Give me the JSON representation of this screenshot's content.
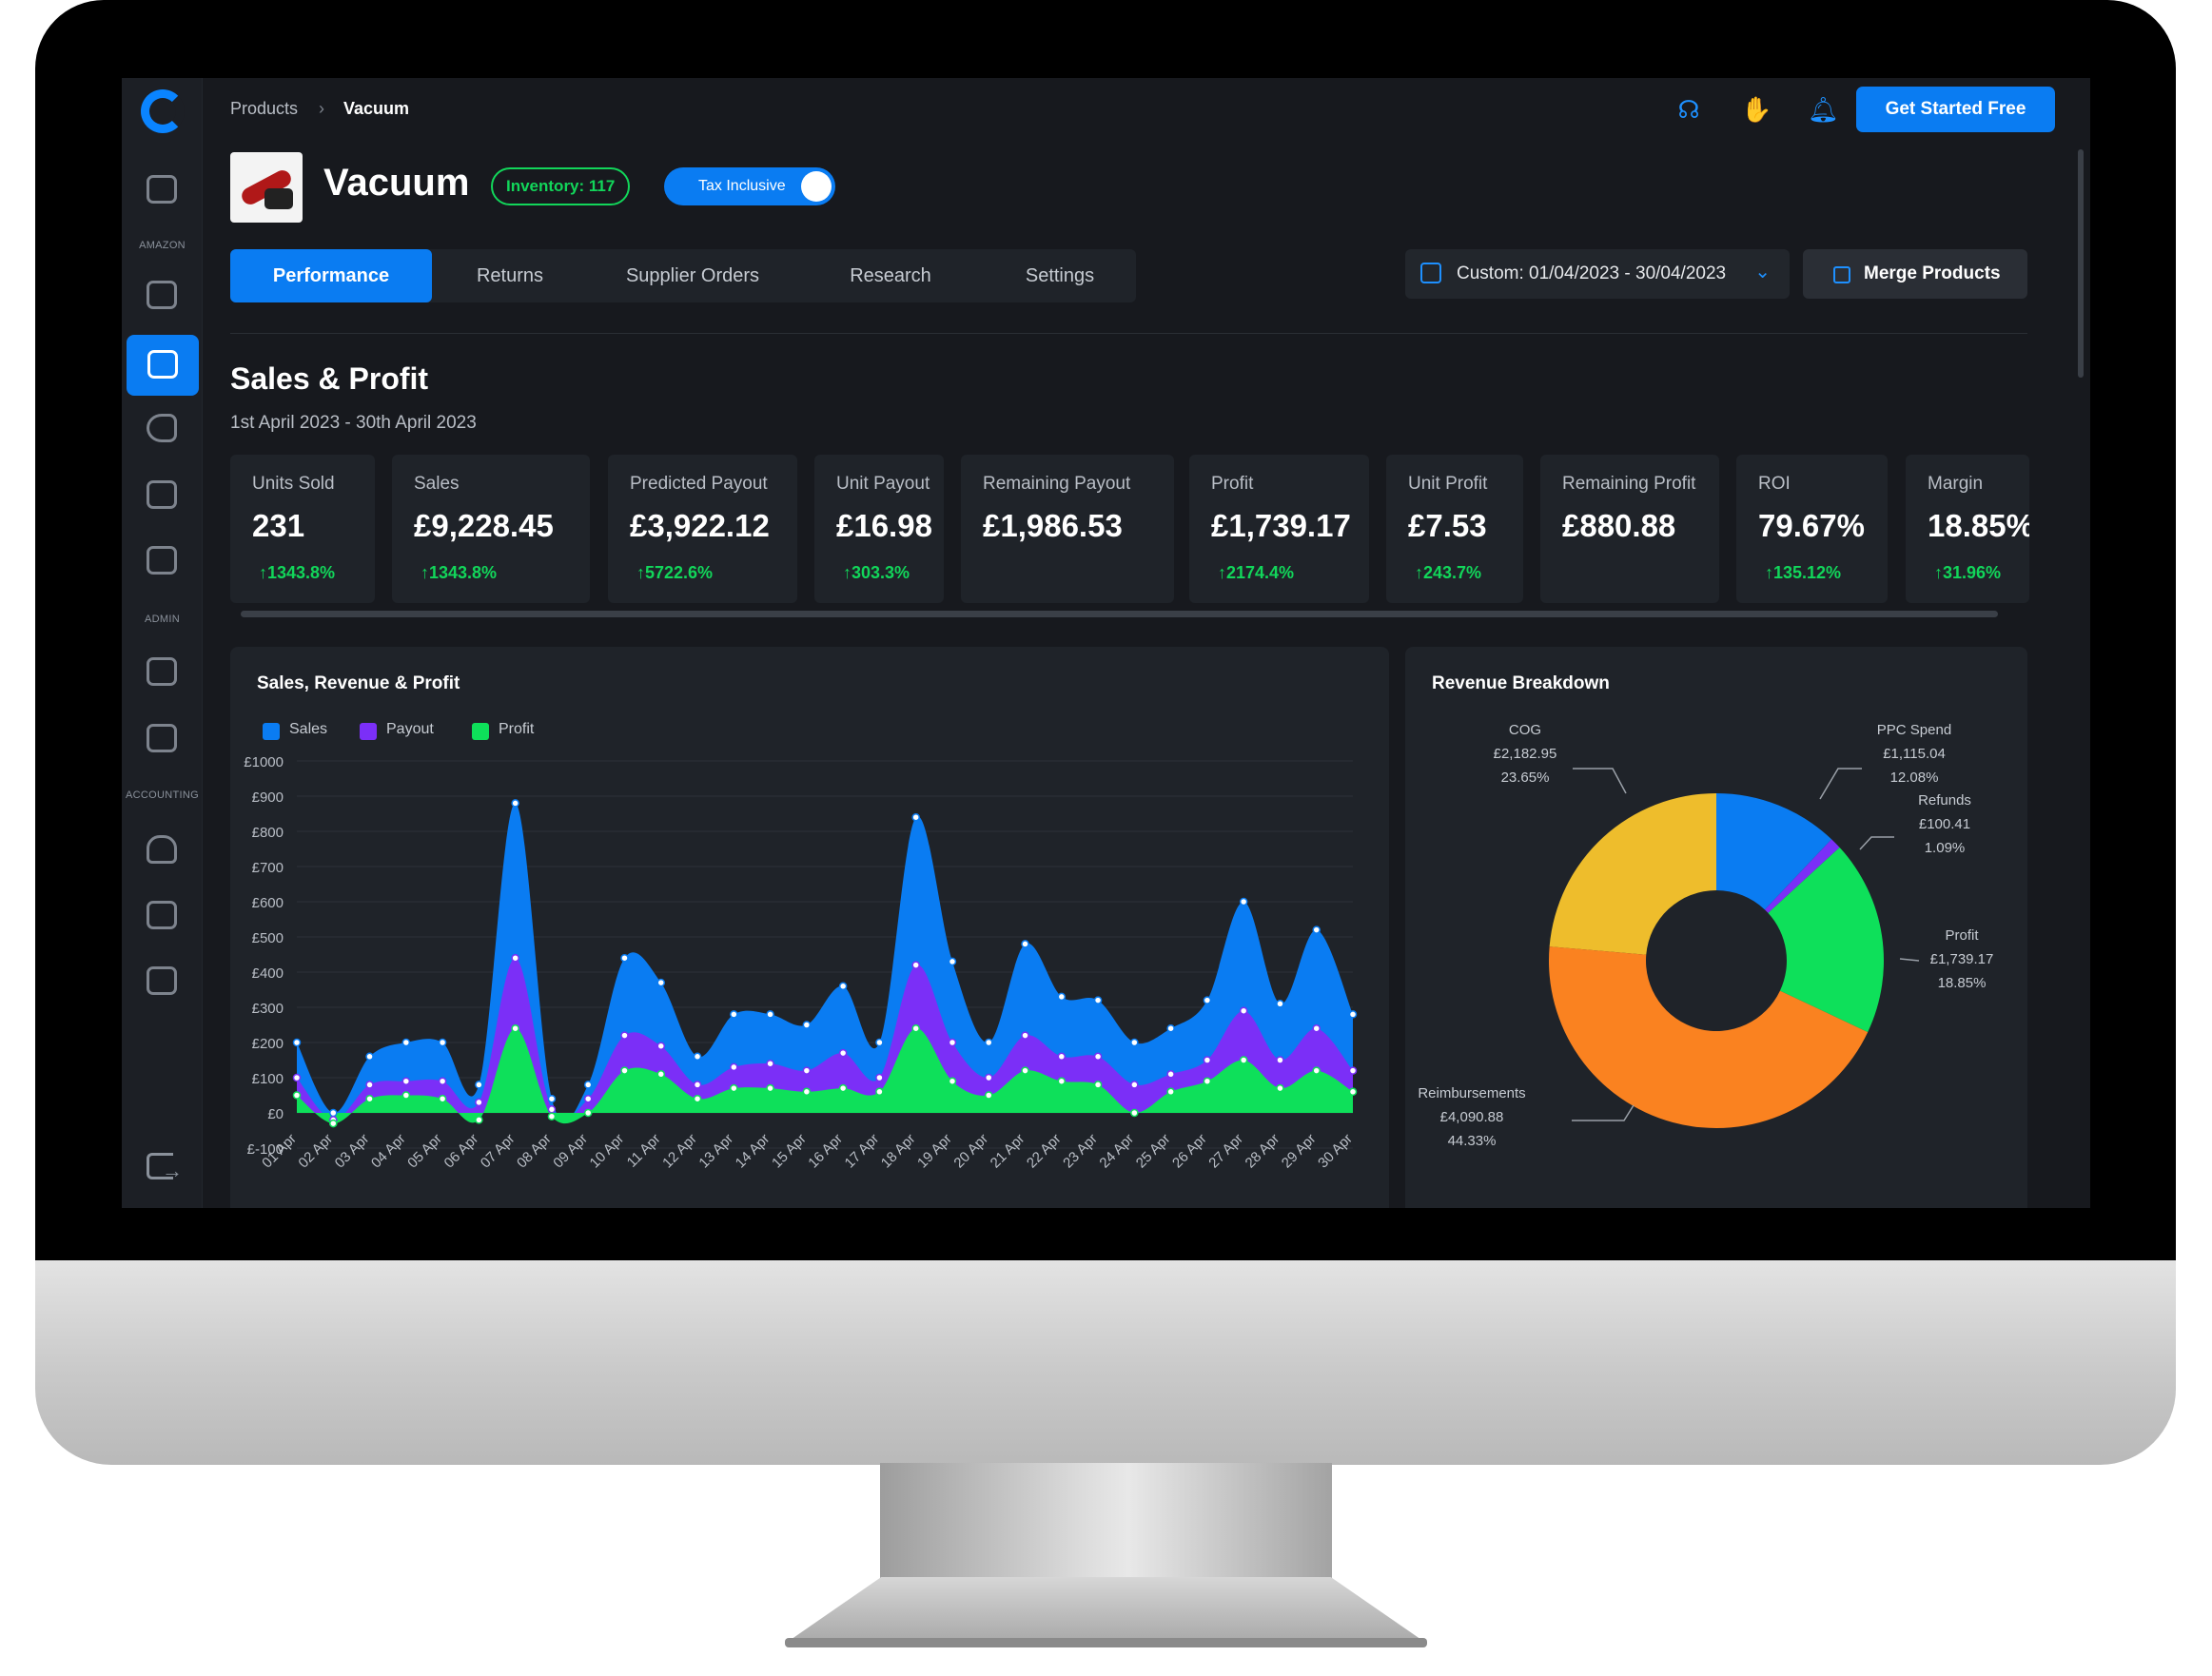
{
  "breadcrumb": {
    "parent": "Products",
    "separator": "›",
    "current": "Vacuum"
  },
  "sidebar": {
    "sections": [
      "AMAZON",
      "ADMIN",
      "ACCOUNTING"
    ],
    "items": [
      {
        "icon": "dashboard-icon"
      },
      {
        "icon": "analytics-icon"
      },
      {
        "icon": "products-icon",
        "active": true
      },
      {
        "icon": "megaphone-icon"
      },
      {
        "icon": "repricer-icon"
      },
      {
        "icon": "reviews-icon"
      },
      {
        "icon": "shipments-icon"
      },
      {
        "icon": "orders-icon"
      },
      {
        "icon": "store-icon"
      },
      {
        "icon": "reports-icon"
      },
      {
        "icon": "wallet-icon"
      },
      {
        "icon": "logout-icon"
      }
    ]
  },
  "header": {
    "cta": "Get Started Free",
    "icons": [
      "support-icon",
      "wave-icon",
      "bell-icon"
    ]
  },
  "product": {
    "title": "Vacuum",
    "inventory": "Inventory: 117",
    "tax_toggle": "Tax Inclusive"
  },
  "tabs": [
    "Performance",
    "Returns",
    "Supplier Orders",
    "Research",
    "Settings"
  ],
  "date_range": "Custom: 01/04/2023 - 30/04/2023",
  "merge_button": "Merge Products",
  "section": {
    "title": "Sales & Profit",
    "subtitle": "1st April 2023 - 30th April 2023"
  },
  "kpis": [
    {
      "label": "Units Sold",
      "value": "231",
      "change": "1343.8%"
    },
    {
      "label": "Sales",
      "value": "£9,228.45",
      "change": "1343.8%"
    },
    {
      "label": "Predicted Payout",
      "value": "£3,922.12",
      "change": "5722.6%"
    },
    {
      "label": "Unit Payout",
      "value": "£16.98",
      "change": "303.3%"
    },
    {
      "label": "Remaining Payout",
      "value": "£1,986.53",
      "change": ""
    },
    {
      "label": "Profit",
      "value": "£1,739.17",
      "change": "2174.4%"
    },
    {
      "label": "Unit Profit",
      "value": "£7.53",
      "change": "243.7%"
    },
    {
      "label": "Remaining Profit",
      "value": "£880.88",
      "change": ""
    },
    {
      "label": "ROI",
      "value": "79.67%",
      "change": "135.12%"
    },
    {
      "label": "Margin",
      "value": "18.85%",
      "change": "31.96%"
    }
  ],
  "colors": {
    "sales": "#0a7cf2",
    "payout": "#7b2ff7",
    "profit": "#0ee05a",
    "cog": "#eebd2c",
    "ppc": "#0a7cf2",
    "refunds": "#7b2ff7",
    "reimbursements": "#fa8220",
    "accent": "#0a7cf2",
    "positive": "#12d65a"
  },
  "chart_data": [
    {
      "type": "area",
      "title": "Sales, Revenue & Profit",
      "x": [
        "01 Apr",
        "02 Apr",
        "03 Apr",
        "04 Apr",
        "05 Apr",
        "06 Apr",
        "07 Apr",
        "08 Apr",
        "09 Apr",
        "10 Apr",
        "11 Apr",
        "12 Apr",
        "13 Apr",
        "14 Apr",
        "15 Apr",
        "16 Apr",
        "17 Apr",
        "18 Apr",
        "19 Apr",
        "20 Apr",
        "21 Apr",
        "22 Apr",
        "23 Apr",
        "24 Apr",
        "25 Apr",
        "26 Apr",
        "27 Apr",
        "28 Apr",
        "29 Apr",
        "30 Apr"
      ],
      "yticks": [
        "£-100",
        "£0",
        "£100",
        "£200",
        "£300",
        "£400",
        "£500",
        "£600",
        "£700",
        "£800",
        "£900",
        "£1000"
      ],
      "ylim": [
        -100,
        1000
      ],
      "grid": true,
      "legend_position": "top-left",
      "series": [
        {
          "name": "Sales",
          "values": [
            200,
            0,
            160,
            200,
            200,
            80,
            880,
            40,
            80,
            440,
            370,
            160,
            280,
            280,
            250,
            360,
            200,
            840,
            430,
            200,
            480,
            330,
            320,
            200,
            240,
            320,
            600,
            310,
            520,
            280
          ]
        },
        {
          "name": "Payout",
          "values": [
            100,
            -20,
            80,
            90,
            90,
            30,
            440,
            10,
            40,
            220,
            190,
            80,
            130,
            140,
            120,
            170,
            100,
            420,
            200,
            100,
            220,
            160,
            160,
            80,
            110,
            150,
            290,
            150,
            240,
            120
          ]
        },
        {
          "name": "Profit",
          "values": [
            50,
            -30,
            40,
            50,
            40,
            -20,
            240,
            -10,
            0,
            120,
            110,
            40,
            70,
            70,
            60,
            70,
            60,
            240,
            90,
            50,
            120,
            90,
            80,
            0,
            60,
            90,
            150,
            70,
            120,
            60
          ]
        }
      ]
    },
    {
      "type": "pie",
      "title": "Revenue Breakdown",
      "slices": [
        {
          "name": "COG",
          "value": 2182.95,
          "value_label": "£2,182.95",
          "percent": "23.65%"
        },
        {
          "name": "PPC Spend",
          "value": 1115.04,
          "value_label": "£1,115.04",
          "percent": "12.08%"
        },
        {
          "name": "Refunds",
          "value": 100.41,
          "value_label": "£100.41",
          "percent": "1.09%"
        },
        {
          "name": "Profit",
          "value": 1739.17,
          "value_label": "£1,739.17",
          "percent": "18.85%"
        },
        {
          "name": "Reimbursements",
          "value": 4090.88,
          "value_label": "£4,090.88",
          "percent": "44.33%"
        }
      ]
    }
  ]
}
